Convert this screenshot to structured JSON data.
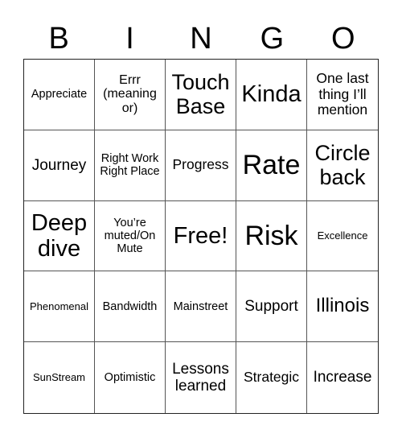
{
  "header": {
    "letters": [
      "B",
      "I",
      "N",
      "G",
      "O"
    ]
  },
  "cells": [
    [
      "Appreciate",
      "Errr (meaning or)",
      "Touch Base",
      "Kinda",
      "One last thing I’ll mention"
    ],
    [
      "Journey",
      "Right Work Right Place",
      "Progress",
      "Rate",
      "Circle back"
    ],
    [
      "Deep dive",
      "You’re muted/On Mute",
      "Free!",
      "Risk",
      "Excellence"
    ],
    [
      "Phenomenal",
      "Bandwidth",
      "Mainstreet",
      "Support",
      "Illinois"
    ],
    [
      "SunStream",
      "Optimistic",
      "Lessons learned",
      "Strategic",
      "Increase"
    ]
  ]
}
